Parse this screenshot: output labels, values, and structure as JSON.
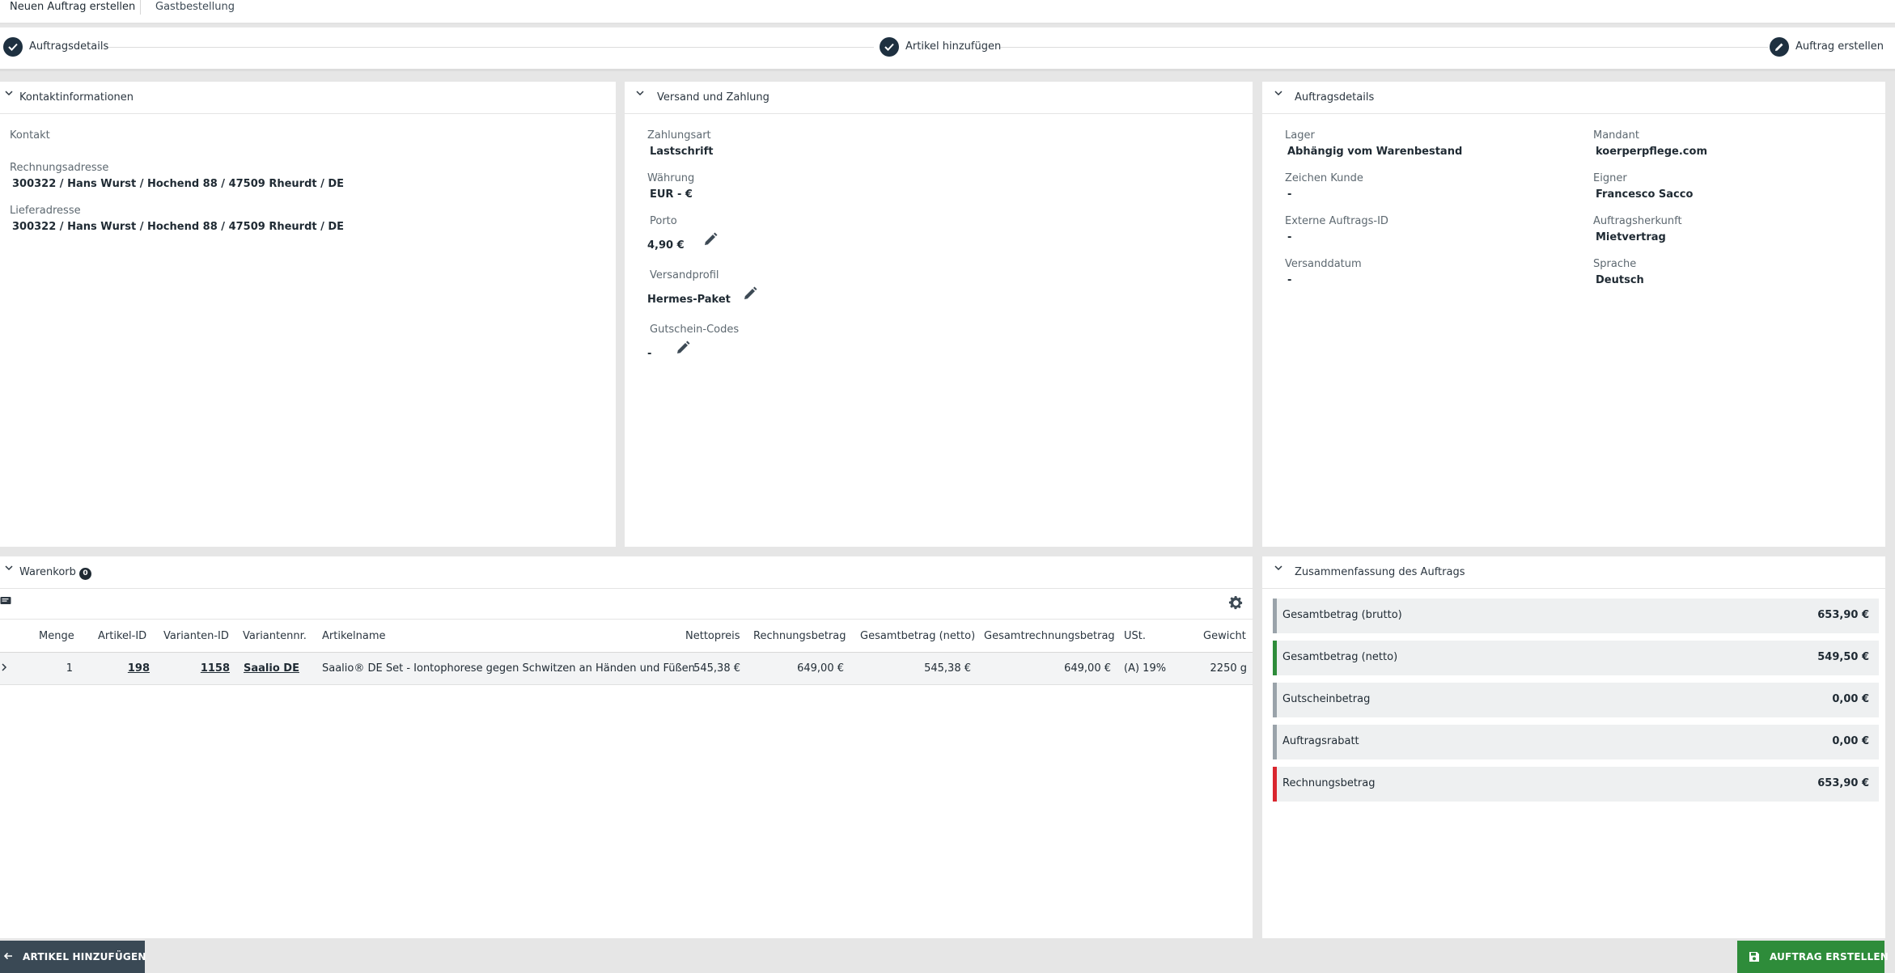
{
  "tabs": {
    "tab1": "Neuen Auftrag erstellen",
    "tab2": "Gastbestellung"
  },
  "stepper": {
    "step1": "Auftragsdetails",
    "step2": "Artikel hinzufügen",
    "step3": "Auftrag erstellen"
  },
  "contact": {
    "title": "Kontaktinformationen",
    "kontakt_label": "Kontakt",
    "billing_label": "Rechnungsadresse",
    "billing_value": "300322 / Hans Wurst / Hochend 88 / 47509 Rheurdt / DE",
    "shipping_label": "Lieferadresse",
    "shipping_value": "300322 / Hans Wurst / Hochend 88 / 47509 Rheurdt / DE"
  },
  "shipping_payment": {
    "title": "Versand und Zahlung",
    "payment_label": "Zahlungsart",
    "payment_value": "Lastschrift",
    "currency_label": "Währung",
    "currency_value": "EUR - €",
    "porto_label": "Porto",
    "porto_value": "4,90 €",
    "profile_label": "Versandprofil",
    "profile_value": "Hermes-Paket",
    "coupon_label": "Gutschein-Codes",
    "coupon_value": "-"
  },
  "order_details": {
    "title": "Auftragsdetails",
    "lager_label": "Lager",
    "lager_value": "Abhängig vom Warenbestand",
    "mandant_label": "Mandant",
    "mandant_value": "koerperpflege.com",
    "zeichen_label": "Zeichen Kunde",
    "zeichen_value": "-",
    "eigner_label": "Eigner",
    "eigner_value": "Francesco Sacco",
    "extern_label": "Externe Auftrags-ID",
    "extern_value": "-",
    "herkunft_label": "Auftragsherkunft",
    "herkunft_value": "Mietvertrag",
    "versanddatum_label": "Versanddatum",
    "versanddatum_value": "-",
    "sprache_label": "Sprache",
    "sprache_value": "Deutsch"
  },
  "cart": {
    "title": "Warenkorb",
    "badge": "0",
    "columns": [
      "Menge",
      "Artikel-ID",
      "Varianten-ID",
      "Variantennr.",
      "Artikelname",
      "Nettopreis",
      "Rechnungsbetrag",
      "Gesamtbetrag (netto)",
      "Gesamtrechnungsbetrag",
      "USt.",
      "Gewicht"
    ],
    "rows": [
      {
        "menge": "1",
        "artikel_id": "198",
        "varianten_id": "1158",
        "variantennr": "Saalio DE",
        "artikelname": "Saalio® DE Set - Iontophorese gegen Schwitzen an Händen und Füßen",
        "nettopreis": "545,38 €",
        "rechnungsbetrag": "649,00 €",
        "gesamt_netto": "545,38 €",
        "gesamtrechnung": "649,00 €",
        "ust": "(A) 19%",
        "gewicht": "2250 g"
      }
    ]
  },
  "summary": {
    "title": "Zusammenfassung des Auftrags",
    "rows": [
      {
        "label": "Gesamtbetrag (brutto)",
        "value": "653,90 €",
        "color": "#9aa3aa"
      },
      {
        "label": "Gesamtbetrag (netto)",
        "value": "549,50 €",
        "color": "#2e8c3a"
      },
      {
        "label": "Gutscheinbetrag",
        "value": "0,00 €",
        "color": "#9aa3aa"
      },
      {
        "label": "Auftragsrabatt",
        "value": "0,00 €",
        "color": "#9aa3aa"
      },
      {
        "label": "Rechnungsbetrag",
        "value": "653,90 €",
        "color": "#d9262e"
      }
    ]
  },
  "buttons": {
    "back": "ARTIKEL HINZUFÜGEN",
    "create": "AUFTRAG ERSTELLEN"
  },
  "colors": {
    "primary_dark": "#1e3040",
    "success": "#2e8c3a",
    "danger": "#d9262e"
  }
}
